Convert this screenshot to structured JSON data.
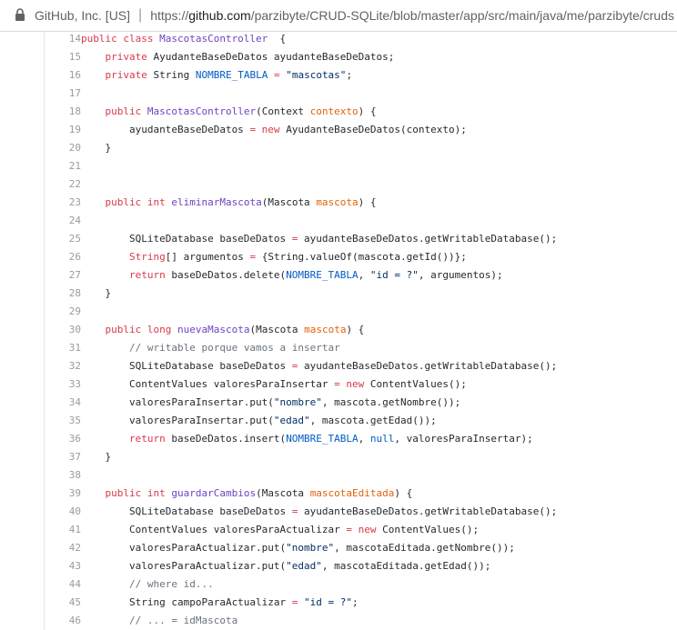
{
  "browser": {
    "site_identity": "GitHub, Inc. [US]",
    "url_prefix": "https://",
    "url_host": "github.com",
    "url_path": "/parzibyte/CRUD-SQLite/blob/master/app/src/main/java/me/parzibyte/cruds",
    "lock_icon": "lock-icon"
  },
  "code": {
    "lines": [
      {
        "n": "14",
        "tokens": [
          [
            "kw",
            "public class "
          ],
          [
            "fn",
            "MascotasController"
          ],
          [
            "",
            "  {"
          ]
        ]
      },
      {
        "n": "15",
        "tokens": [
          [
            "",
            "    "
          ],
          [
            "kw",
            "private "
          ],
          [
            "",
            "AyudanteBaseDeDatos ayudanteBaseDeDatos;"
          ]
        ]
      },
      {
        "n": "16",
        "tokens": [
          [
            "",
            "    "
          ],
          [
            "kw",
            "private "
          ],
          [
            "",
            "String "
          ],
          [
            "cn",
            "NOMBRE_TABLA"
          ],
          [
            "kw",
            " = "
          ],
          [
            "str",
            "\"mascotas\""
          ],
          [
            "",
            ";"
          ]
        ]
      },
      {
        "n": "17",
        "tokens": []
      },
      {
        "n": "18",
        "tokens": [
          [
            "",
            "    "
          ],
          [
            "kw",
            "public "
          ],
          [
            "fn",
            "MascotasController"
          ],
          [
            "",
            "(Context "
          ],
          [
            "var",
            "contexto"
          ],
          [
            "",
            ") {"
          ]
        ]
      },
      {
        "n": "19",
        "tokens": [
          [
            "",
            "        ayudanteBaseDeDatos "
          ],
          [
            "kw",
            "= new "
          ],
          [
            "",
            "AyudanteBaseDeDatos(contexto);"
          ]
        ]
      },
      {
        "n": "20",
        "tokens": [
          [
            "",
            "    }"
          ]
        ]
      },
      {
        "n": "21",
        "tokens": []
      },
      {
        "n": "22",
        "tokens": []
      },
      {
        "n": "23",
        "tokens": [
          [
            "",
            "    "
          ],
          [
            "kw",
            "public int "
          ],
          [
            "fn",
            "eliminarMascota"
          ],
          [
            "",
            "(Mascota "
          ],
          [
            "var",
            "mascota"
          ],
          [
            "",
            ") {"
          ]
        ]
      },
      {
        "n": "24",
        "tokens": []
      },
      {
        "n": "25",
        "tokens": [
          [
            "",
            "        SQLiteDatabase baseDeDatos "
          ],
          [
            "kw",
            "= "
          ],
          [
            "",
            "ayudanteBaseDeDatos.getWritableDatabase();"
          ]
        ]
      },
      {
        "n": "26",
        "tokens": [
          [
            "",
            "        "
          ],
          [
            "kw",
            "String"
          ],
          [
            "",
            "[] argumentos "
          ],
          [
            "kw",
            "= "
          ],
          [
            "",
            "{String.valueOf(mascota.getId())};"
          ]
        ]
      },
      {
        "n": "27",
        "tokens": [
          [
            "",
            "        "
          ],
          [
            "kw",
            "return "
          ],
          [
            "",
            "baseDeDatos.delete("
          ],
          [
            "cn",
            "NOMBRE_TABLA"
          ],
          [
            "",
            ", "
          ],
          [
            "str",
            "\"id = ?\""
          ],
          [
            "",
            ", argumentos);"
          ]
        ]
      },
      {
        "n": "28",
        "tokens": [
          [
            "",
            "    }"
          ]
        ]
      },
      {
        "n": "29",
        "tokens": []
      },
      {
        "n": "30",
        "tokens": [
          [
            "",
            "    "
          ],
          [
            "kw",
            "public long "
          ],
          [
            "fn",
            "nuevaMascota"
          ],
          [
            "",
            "(Mascota "
          ],
          [
            "var",
            "mascota"
          ],
          [
            "",
            ") {"
          ]
        ]
      },
      {
        "n": "31",
        "tokens": [
          [
            "",
            "        "
          ],
          [
            "cm",
            "// writable porque vamos a insertar"
          ]
        ]
      },
      {
        "n": "32",
        "tokens": [
          [
            "",
            "        SQLiteDatabase baseDeDatos "
          ],
          [
            "kw",
            "= "
          ],
          [
            "",
            "ayudanteBaseDeDatos.getWritableDatabase();"
          ]
        ]
      },
      {
        "n": "33",
        "tokens": [
          [
            "",
            "        ContentValues valoresParaInsertar "
          ],
          [
            "kw",
            "= new "
          ],
          [
            "",
            "ContentValues();"
          ]
        ]
      },
      {
        "n": "34",
        "tokens": [
          [
            "",
            "        valoresParaInsertar.put("
          ],
          [
            "str",
            "\"nombre\""
          ],
          [
            "",
            ", mascota.getNombre());"
          ]
        ]
      },
      {
        "n": "35",
        "tokens": [
          [
            "",
            "        valoresParaInsertar.put("
          ],
          [
            "str",
            "\"edad\""
          ],
          [
            "",
            ", mascota.getEdad());"
          ]
        ]
      },
      {
        "n": "36",
        "tokens": [
          [
            "",
            "        "
          ],
          [
            "kw",
            "return "
          ],
          [
            "",
            "baseDeDatos.insert("
          ],
          [
            "cn",
            "NOMBRE_TABLA"
          ],
          [
            "",
            ", "
          ],
          [
            "cn",
            "null"
          ],
          [
            "",
            ", valoresParaInsertar);"
          ]
        ]
      },
      {
        "n": "37",
        "tokens": [
          [
            "",
            "    }"
          ]
        ]
      },
      {
        "n": "38",
        "tokens": []
      },
      {
        "n": "39",
        "tokens": [
          [
            "",
            "    "
          ],
          [
            "kw",
            "public int "
          ],
          [
            "fn",
            "guardarCambios"
          ],
          [
            "",
            "(Mascota "
          ],
          [
            "var",
            "mascotaEditada"
          ],
          [
            "",
            ") {"
          ]
        ]
      },
      {
        "n": "40",
        "tokens": [
          [
            "",
            "        SQLiteDatabase baseDeDatos "
          ],
          [
            "kw",
            "= "
          ],
          [
            "",
            "ayudanteBaseDeDatos.getWritableDatabase();"
          ]
        ]
      },
      {
        "n": "41",
        "tokens": [
          [
            "",
            "        ContentValues valoresParaActualizar "
          ],
          [
            "kw",
            "= new "
          ],
          [
            "",
            "ContentValues();"
          ]
        ]
      },
      {
        "n": "42",
        "tokens": [
          [
            "",
            "        valoresParaActualizar.put("
          ],
          [
            "str",
            "\"nombre\""
          ],
          [
            "",
            ", mascotaEditada.getNombre());"
          ]
        ]
      },
      {
        "n": "43",
        "tokens": [
          [
            "",
            "        valoresParaActualizar.put("
          ],
          [
            "str",
            "\"edad\""
          ],
          [
            "",
            ", mascotaEditada.getEdad());"
          ]
        ]
      },
      {
        "n": "44",
        "tokens": [
          [
            "",
            "        "
          ],
          [
            "cm",
            "// where id..."
          ]
        ]
      },
      {
        "n": "45",
        "tokens": [
          [
            "",
            "        String campoParaActualizar "
          ],
          [
            "kw",
            "= "
          ],
          [
            "str",
            "\"id = ?\""
          ],
          [
            "",
            ";"
          ]
        ]
      },
      {
        "n": "46",
        "tokens": [
          [
            "",
            "        "
          ],
          [
            "cm",
            "// ... = idMascota"
          ]
        ]
      }
    ]
  }
}
